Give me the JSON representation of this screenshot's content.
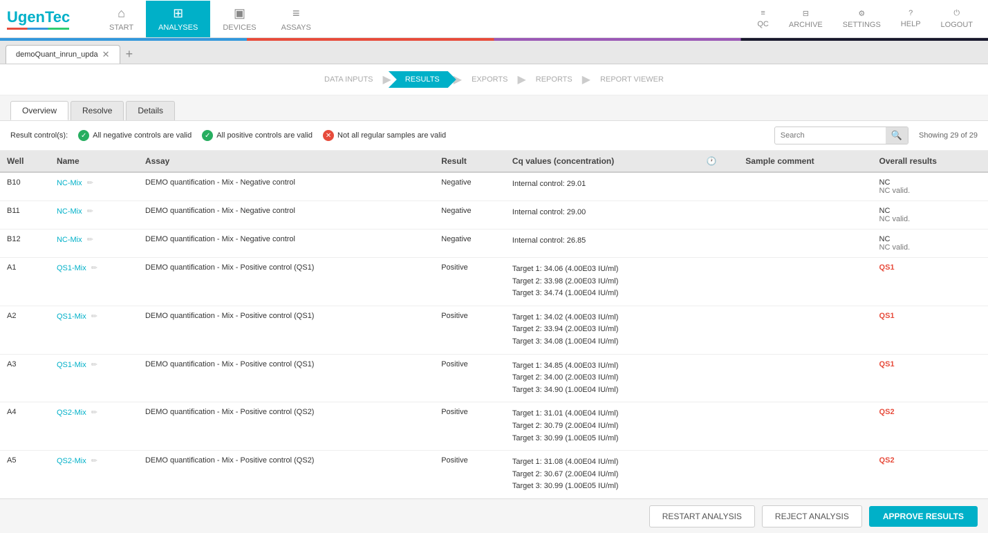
{
  "app": {
    "logo": "UgenTec",
    "logo_bar_colors": [
      "#e74c3c",
      "#3498db",
      "#2ecc71"
    ]
  },
  "nav": {
    "items": [
      {
        "id": "start",
        "label": "START",
        "icon": "⌂",
        "active": false
      },
      {
        "id": "analyses",
        "label": "ANALYSES",
        "icon": "⊞",
        "active": true
      },
      {
        "id": "devices",
        "label": "DEVICES",
        "icon": "▣",
        "active": false
      },
      {
        "id": "assays",
        "label": "ASSAYS",
        "icon": "≡",
        "active": false
      }
    ],
    "right_items": [
      {
        "id": "qc",
        "label": "QC",
        "icon": "≡"
      },
      {
        "id": "archive",
        "label": "ARCHIVE",
        "icon": "⊟"
      },
      {
        "id": "settings",
        "label": "SETTINGS",
        "icon": "⚙"
      },
      {
        "id": "help",
        "label": "HELP",
        "icon": "?"
      },
      {
        "id": "logout",
        "label": "LOGOUT",
        "icon": "⏻"
      }
    ]
  },
  "tabs": [
    {
      "label": "demoQuant_inrun_upda",
      "active": true
    }
  ],
  "workflow": {
    "steps": [
      {
        "label": "DATA INPUTS",
        "active": false
      },
      {
        "label": "RESULTS",
        "active": true
      },
      {
        "label": "EXPORTS",
        "active": false
      },
      {
        "label": "REPORTS",
        "active": false
      },
      {
        "label": "REPORT VIEWER",
        "active": false
      }
    ]
  },
  "sub_tabs": [
    {
      "label": "Overview",
      "active": true
    },
    {
      "label": "Resolve",
      "active": false
    },
    {
      "label": "Details",
      "active": false
    }
  ],
  "controls": {
    "items": [
      {
        "type": "green",
        "text": "All negative controls are valid"
      },
      {
        "type": "green",
        "text": "All positive controls are valid"
      },
      {
        "type": "red",
        "text": "Not all regular samples are valid"
      }
    ],
    "result_label": "Result control(s):",
    "search_placeholder": "Search",
    "showing": "Showing 29 of 29"
  },
  "table": {
    "columns": [
      "Well",
      "Name",
      "Assay",
      "Result",
      "Cq values (concentration)",
      "",
      "Sample comment",
      "Overall results"
    ],
    "rows": [
      {
        "well": "B10",
        "name": "NC-Mix",
        "assay": "DEMO quantification - Mix - Negative control",
        "result": "Negative",
        "cq": "Internal control: 29.01",
        "sample_comment": "",
        "overall_main": "NC",
        "overall_sub": "NC valid."
      },
      {
        "well": "B11",
        "name": "NC-Mix",
        "assay": "DEMO quantification - Mix - Negative control",
        "result": "Negative",
        "cq": "Internal control: 29.00",
        "sample_comment": "",
        "overall_main": "NC",
        "overall_sub": "NC valid."
      },
      {
        "well": "B12",
        "name": "NC-Mix",
        "assay": "DEMO quantification - Mix - Negative control",
        "result": "Negative",
        "cq": "Internal control: 26.85",
        "sample_comment": "",
        "overall_main": "NC",
        "overall_sub": "NC valid."
      },
      {
        "well": "A1",
        "name": "QS1-Mix",
        "assay": "DEMO quantification - Mix - Positive control (QS1)",
        "result": "Positive",
        "cq": "Target 1: 34.06 (4.00E03 IU/ml)\nTarget 2: 33.98 (2.00E03 IU/ml)\nTarget 3: 34.74 (1.00E04 IU/ml)",
        "sample_comment": "",
        "overall_main": "QS1",
        "overall_sub": "",
        "overall_red": true
      },
      {
        "well": "A2",
        "name": "QS1-Mix",
        "assay": "DEMO quantification - Mix - Positive control (QS1)",
        "result": "Positive",
        "cq": "Target 1: 34.02 (4.00E03 IU/ml)\nTarget 2: 33.94 (2.00E03 IU/ml)\nTarget 3: 34.08 (1.00E04 IU/ml)",
        "sample_comment": "",
        "overall_main": "QS1",
        "overall_sub": "",
        "overall_red": true
      },
      {
        "well": "A3",
        "name": "QS1-Mix",
        "assay": "DEMO quantification - Mix - Positive control (QS1)",
        "result": "Positive",
        "cq": "Target 1: 34.85 (4.00E03 IU/ml)\nTarget 2: 34.00 (2.00E03 IU/ml)\nTarget 3: 34.90 (1.00E04 IU/ml)",
        "sample_comment": "",
        "overall_main": "QS1",
        "overall_sub": "",
        "overall_red": true
      },
      {
        "well": "A4",
        "name": "QS2-Mix",
        "assay": "DEMO quantification - Mix - Positive control (QS2)",
        "result": "Positive",
        "cq": "Target 1: 31.01 (4.00E04 IU/ml)\nTarget 2: 30.79 (2.00E04 IU/ml)\nTarget 3: 30.99 (1.00E05 IU/ml)",
        "sample_comment": "",
        "overall_main": "QS2",
        "overall_sub": "",
        "overall_red": true
      },
      {
        "well": "A5",
        "name": "QS2-Mix",
        "assay": "DEMO quantification - Mix - Positive control (QS2)",
        "result": "Positive",
        "cq": "Target 1: 31.08 (4.00E04 IU/ml)\nTarget 2: 30.67 (2.00E04 IU/ml)\nTarget 3: 30.99 (1.00E05 IU/ml)",
        "sample_comment": "",
        "overall_main": "QS2",
        "overall_sub": "",
        "overall_red": true
      }
    ]
  },
  "buttons": {
    "restart": "RESTART ANALYSIS",
    "reject": "REJECT ANALYSIS",
    "approve": "APPROVE RESULTS"
  }
}
